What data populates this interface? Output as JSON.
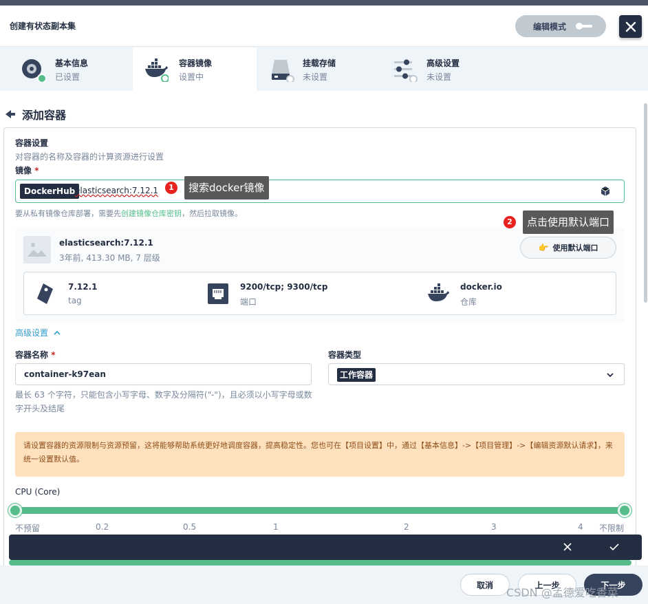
{
  "header": {
    "title": "创建有状态副本集",
    "edit_mode_label": "编辑模式"
  },
  "steps": [
    {
      "name": "基本信息",
      "status": "已设置",
      "icon": "disc-icon"
    },
    {
      "name": "容器镜像",
      "status": "设置中",
      "icon": "docker-icon"
    },
    {
      "name": "挂载存储",
      "status": "未设置",
      "icon": "storage-icon"
    },
    {
      "name": "高级设置",
      "status": "未设置",
      "icon": "sliders-icon"
    }
  ],
  "panel": {
    "back_title": "添加容器"
  },
  "container_settings": {
    "title": "容器设置",
    "desc": "对容器的名称及容器的计算资源进行设置",
    "image_label": "镜像",
    "required_mark": "*",
    "registry_tag": "DockerHub",
    "image_value": "elasticsearch:7.12.1",
    "hint_prefix": "要从私有镜像仓库部署，需要先",
    "hint_link": "创建镜像仓库密钥",
    "hint_suffix": "，然后拉取镜像。"
  },
  "image_info": {
    "name": "elasticsearch:7.12.1",
    "meta": "3年前, 413.30 MB, 7 层级",
    "default_port_button": "使用默认端口",
    "attrs": [
      {
        "value": "7.12.1",
        "label": "tag",
        "icon": "tag-icon"
      },
      {
        "value": "9200/tcp; 9300/tcp",
        "label": "端口",
        "icon": "port-icon"
      },
      {
        "value": "docker.io",
        "label": "仓库",
        "icon": "docker-icon"
      }
    ]
  },
  "advanced": {
    "toggle_label": "高级设置",
    "name_label": "容器名称",
    "name_value": "container-k97ean",
    "type_label": "容器类型",
    "type_value": "工作容器",
    "name_rule": "最长 63 个字符，只能包含小写字母、数字及分隔符(\"-\")，且必须以小写字母或数字开头及结尾"
  },
  "warning": "请设置容器的资源限制与资源预留，这将能够帮助系统更好地调度容器，提高稳定性。您也可在【项目设置】中，通过【基本信息】->【项目管理】->【编辑资源默认请求】，来统一设置默认值。",
  "cpu": {
    "label": "CPU (Core)",
    "ticks": [
      "不预留",
      "0.2",
      "0.5",
      "1",
      "2",
      "3",
      "4",
      "不限制"
    ],
    "range": [
      0,
      1
    ]
  },
  "annotations": [
    {
      "num": "1",
      "text": "搜索docker镜像"
    },
    {
      "num": "2",
      "text": "点击使用默认端口"
    }
  ],
  "footer": {
    "cancel": "取消",
    "prev": "上一步",
    "next": "下一步",
    "watermark": "CSDN @孟德爱吃香菜"
  },
  "colors": {
    "accent": "#55bc8a",
    "dark": "#242e42",
    "warn_bg": "#ffe1be"
  }
}
